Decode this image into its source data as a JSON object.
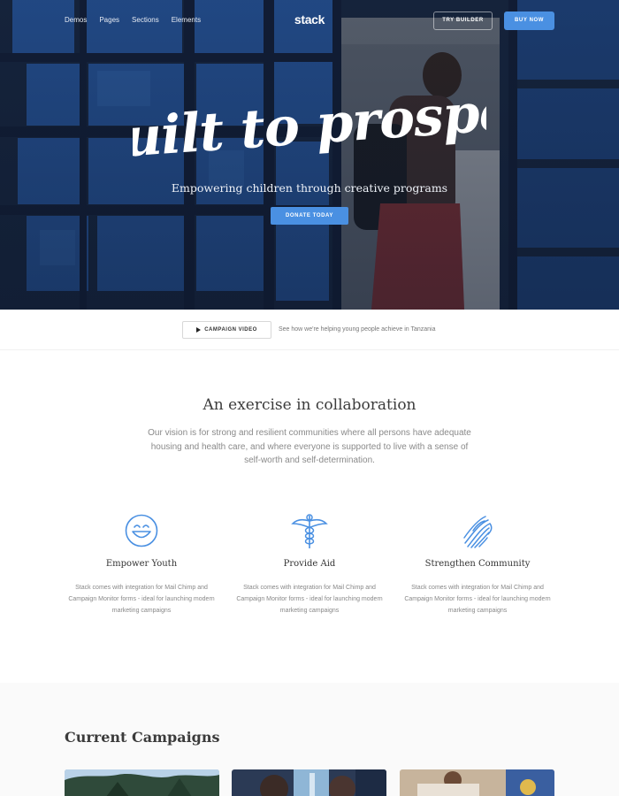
{
  "nav": {
    "links": [
      "Demos",
      "Pages",
      "Sections",
      "Elements"
    ],
    "brand": "stack",
    "try_builder": "TRY BUILDER",
    "buy_now": "BUY NOW"
  },
  "hero": {
    "title": "Built to prosper",
    "subtitle": "Empowering children through creative programs",
    "cta": "DONATE TODAY"
  },
  "video": {
    "button": "CAMPAIGN VIDEO",
    "caption": "See how we're helping young people achieve in Tanzania"
  },
  "intro": {
    "title": "An exercise in collaboration",
    "text": "Our vision is for strong and resilient communities where all persons have adequate housing and health care, and where everyone is supported to live with a sense of self-worth and self-determination."
  },
  "features": [
    {
      "icon": "smiley-icon",
      "title": "Empower Youth",
      "text": "Stack comes with integration for Mail Chimp and Campaign Monitor forms - ideal for launching modern marketing campaigns"
    },
    {
      "icon": "caduceus-icon",
      "title": "Provide Aid",
      "text": "Stack comes with integration for Mail Chimp and Campaign Monitor forms - ideal for launching modern marketing campaigns"
    },
    {
      "icon": "fingerprint-icon",
      "title": "Strengthen Community",
      "text": "Stack comes with integration for Mail Chimp and Campaign Monitor forms - ideal for launching modern marketing campaigns"
    }
  ],
  "campaigns": {
    "title": "Current Campaigns"
  },
  "colors": {
    "accent": "#4a90e2",
    "hero_blue": "#2a5fa8",
    "heading": "#3b3b3b",
    "body_text": "#8a8a8a"
  }
}
